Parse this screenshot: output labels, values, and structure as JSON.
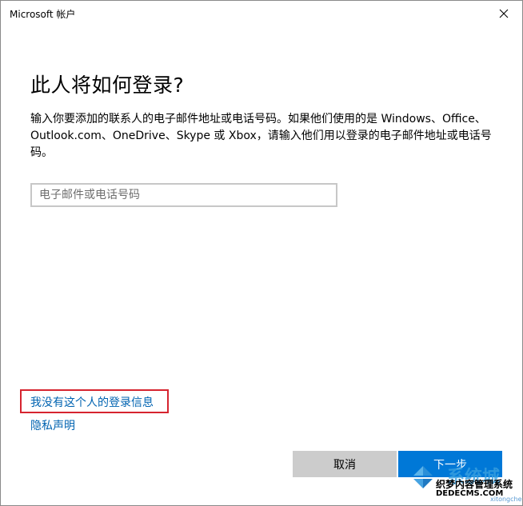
{
  "window": {
    "title": "Microsoft 帐户"
  },
  "icons": {
    "close": "close-icon",
    "watermark_logo": "windows-logo-icon"
  },
  "main": {
    "heading": "此人将如何登录?",
    "description": "输入你要添加的联系人的电子邮件地址或电话号码。如果他们使用的是 Windows、Office、Outlook.com、OneDrive、Skype 或 Xbox，请输入他们用以登录的电子邮件地址或电话号码。",
    "email_input": {
      "value": "",
      "placeholder": "电子邮件或电话号码"
    }
  },
  "links": {
    "no_info": "我没有这个人的登录信息",
    "privacy": "隐私声明"
  },
  "buttons": {
    "cancel": "取消",
    "next": "下一步"
  },
  "watermark": {
    "brand": "系统城",
    "sub": "织梦内容管理系统",
    "domain": "DEDECMS.COM",
    "domain2": "xitongcheng.com"
  },
  "colors": {
    "accent": "#0078d7",
    "link": "#0063b1",
    "cancel_bg": "#cccccc",
    "highlight_box": "#d6242f",
    "input_border": "#c7c7c7"
  }
}
